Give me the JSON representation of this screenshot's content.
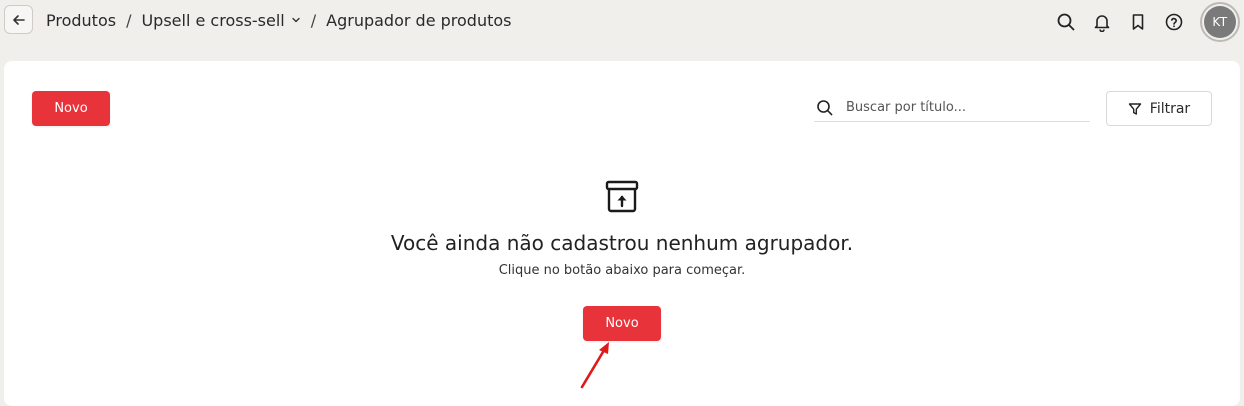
{
  "topbar": {
    "back_icon": "arrow-left-icon",
    "breadcrumb": {
      "item1": "Produtos",
      "separator": "/",
      "item2": "Upsell e cross-sell",
      "item3": "Agrupador de produtos"
    },
    "icons": [
      "search-icon",
      "bell-icon",
      "bookmark-icon",
      "help-icon"
    ],
    "avatar_initials": "KT"
  },
  "toolbar": {
    "new_label": "Novo",
    "search_placeholder": "Buscar por título...",
    "filter_label": "Filtrar"
  },
  "empty_state": {
    "icon": "archive-upload-icon",
    "title": "Você ainda não cadastrou nenhum agrupador.",
    "subtitle": "Clique no botão abaixo para começar.",
    "button_label": "Novo"
  },
  "colors": {
    "primary": "#e8333a",
    "annotation_arrow": "#e01919",
    "page_bg": "#f1efec",
    "card_bg": "#ffffff"
  }
}
